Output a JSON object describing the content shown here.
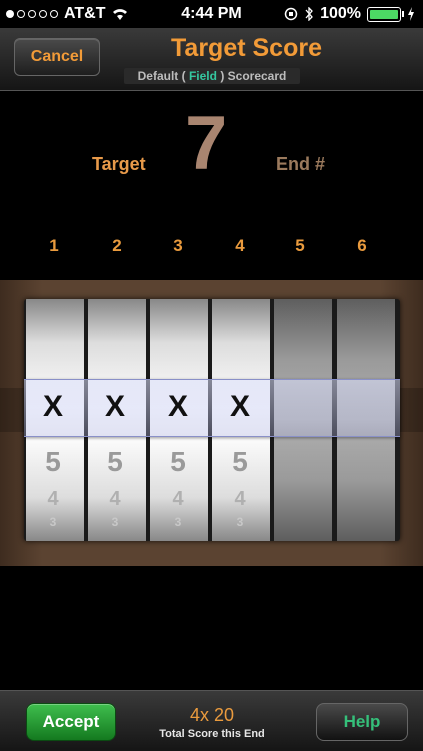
{
  "status_bar": {
    "carrier": "AT&T",
    "time": "4:44 PM",
    "battery": "100%",
    "signal_bars_filled": 1,
    "signal_bars_total": 5
  },
  "nav": {
    "cancel_label": "Cancel",
    "title": "Target Score",
    "subtitle_prefix": "Default (",
    "subtitle_highlight": "Field",
    "subtitle_suffix": ") Scorecard"
  },
  "target": {
    "label": "Target",
    "value": "7",
    "end_label": "End #"
  },
  "columns": [
    "1",
    "2",
    "3",
    "4",
    "5",
    "6"
  ],
  "picker": {
    "wheels": [
      {
        "selected": "X",
        "below": [
          "5",
          "4",
          "3"
        ]
      },
      {
        "selected": "X",
        "below": [
          "5",
          "4",
          "3"
        ]
      },
      {
        "selected": "X",
        "below": [
          "5",
          "4",
          "3"
        ]
      },
      {
        "selected": "X",
        "below": [
          "5",
          "4",
          "3"
        ]
      },
      {
        "selected": "",
        "below": [
          "",
          "",
          ""
        ]
      },
      {
        "selected": "",
        "below": [
          "",
          "",
          ""
        ]
      }
    ]
  },
  "bottom": {
    "accept_label": "Accept",
    "score": "4x 20",
    "score_label": "Total Score this End",
    "help_label": "Help"
  },
  "colors": {
    "accent_orange": "#f29b38",
    "accent_teal": "#35c7a0",
    "accept_green": "#2aa638"
  }
}
